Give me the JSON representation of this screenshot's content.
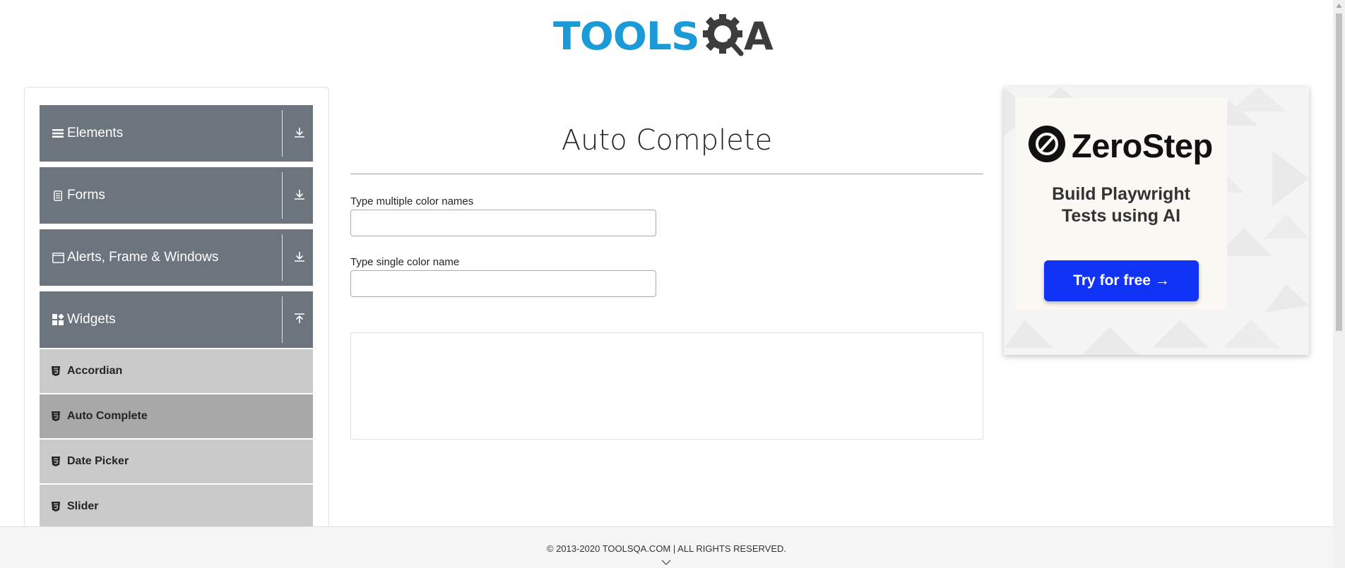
{
  "header": {
    "logo_part1": "TOOLS",
    "logo_part2": "A"
  },
  "colors": {
    "brand_blue": "#1a9ad6",
    "sidebar_header": "#6c757d",
    "menu_item": "#cacaca",
    "menu_item_active": "#a8a8a8",
    "cta_blue": "#1133f5"
  },
  "sidebar": {
    "groups": [
      {
        "label": "Elements",
        "icon": "list-icon",
        "arrow": "download-icon"
      },
      {
        "label": "Forms",
        "icon": "document-icon",
        "arrow": "download-icon"
      },
      {
        "label": "Alerts, Frame & Windows",
        "icon": "window-icon",
        "arrow": "download-icon"
      },
      {
        "label": "Widgets",
        "icon": "widgets-icon",
        "arrow": "upload-icon"
      }
    ],
    "items": [
      {
        "label": "Accordian",
        "icon": "html5-icon",
        "active": false
      },
      {
        "label": "Auto Complete",
        "icon": "html5-icon",
        "active": true
      },
      {
        "label": "Date Picker",
        "icon": "html5-icon",
        "active": false
      },
      {
        "label": "Slider",
        "icon": "html5-icon",
        "active": false
      }
    ]
  },
  "main": {
    "title": "Auto Complete",
    "multiple_label": "Type multiple color names",
    "multiple_value": "",
    "single_label": "Type single color name",
    "single_value": ""
  },
  "ad": {
    "brand": "ZeroStep",
    "headline_line1": "Build Playwright",
    "headline_line2": "Tests using AI",
    "cta": "Try for free →"
  },
  "footer": {
    "text": "© 2013-2020 TOOLSQA.COM | ALL RIGHTS RESERVED."
  }
}
